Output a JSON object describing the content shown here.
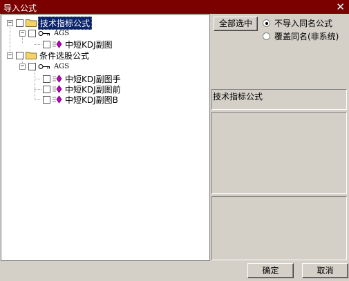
{
  "window": {
    "title": "导入公式",
    "close_glyph": "✕"
  },
  "tree": {
    "nodes": [
      {
        "label": "技术指标公式",
        "expander": "−"
      },
      {
        "label": "AGS",
        "expander": "−"
      },
      {
        "label": "中短KDJ副图"
      },
      {
        "label": "条件选股公式",
        "expander": "−"
      },
      {
        "label": "AGS",
        "expander": "−"
      },
      {
        "label": "中短KDJ副图手"
      },
      {
        "label": "中短KDJ副图前"
      },
      {
        "label": "中短KDJ副图B"
      }
    ]
  },
  "controls": {
    "select_all_label": "全部选中",
    "radio_no_import": "不导入同名公式",
    "radio_overwrite": "覆盖同名(非系统)",
    "selected_radio": "radio_no_import"
  },
  "info": {
    "category_text": "技术指标公式"
  },
  "footer": {
    "ok_label": "确定",
    "cancel_label": "取消"
  },
  "colors": {
    "titlebar": "#7b0000",
    "selection": "#0a246a",
    "folder": "#f3d36a",
    "formula_icon": "#c000c0"
  }
}
